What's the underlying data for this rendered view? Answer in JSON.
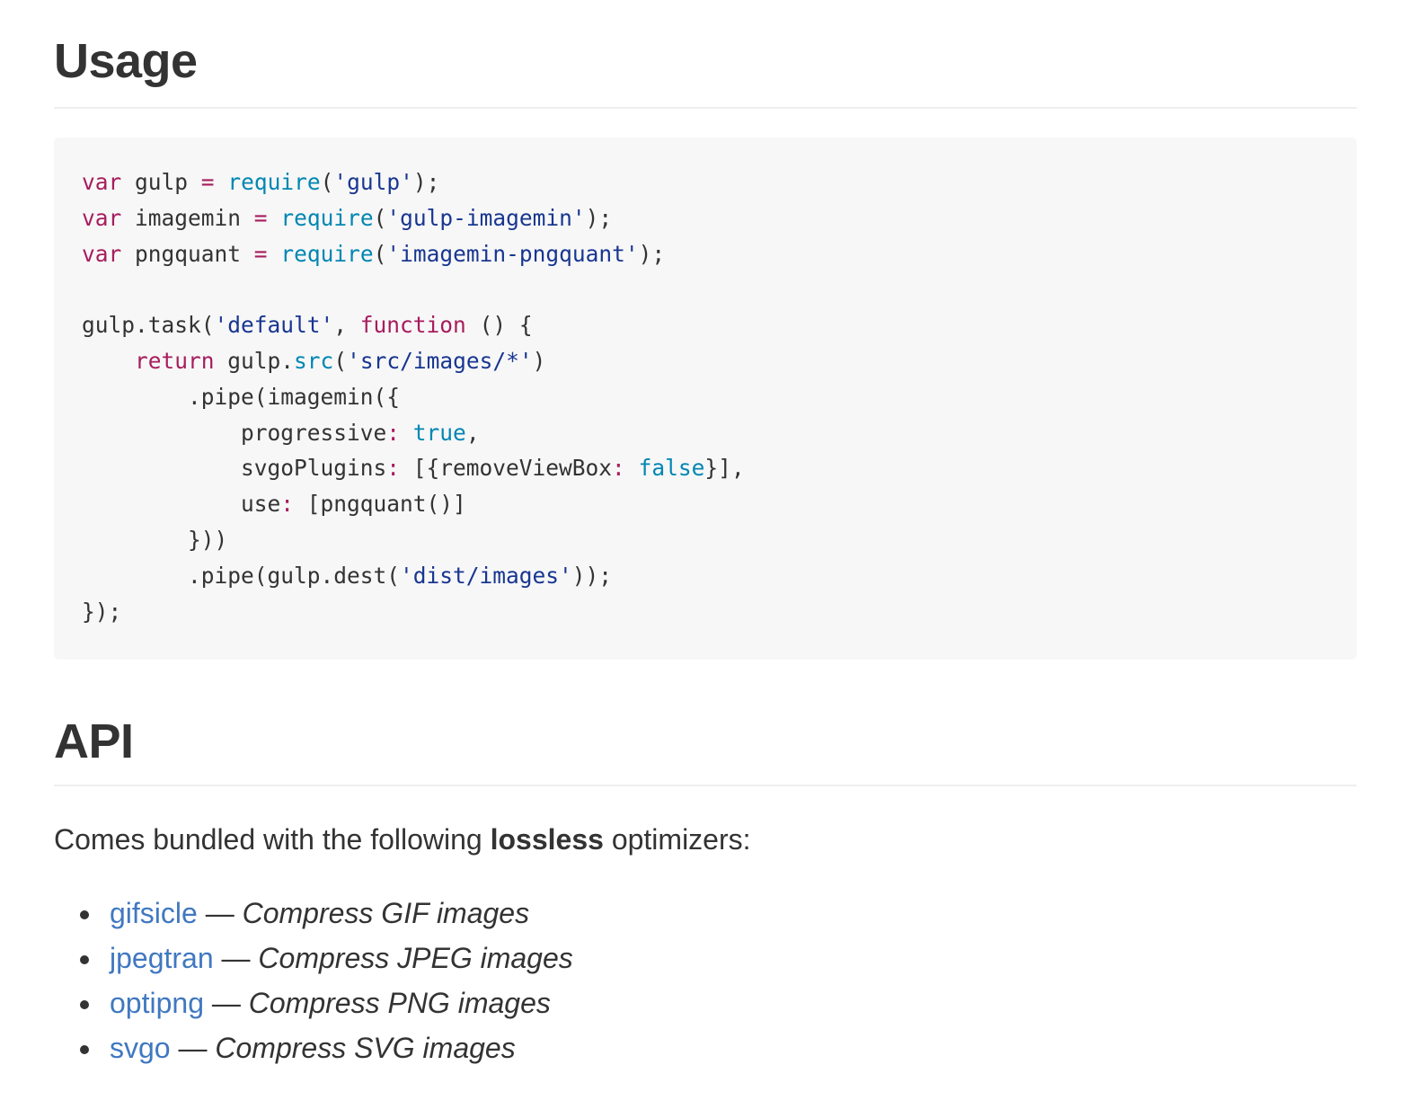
{
  "usage": {
    "heading": "Usage"
  },
  "code": {
    "lines": [
      [
        {
          "t": "kw",
          "v": "var"
        },
        {
          "t": "plain",
          "v": " gulp "
        },
        {
          "t": "op",
          "v": "="
        },
        {
          "t": "plain",
          "v": " "
        },
        {
          "t": "fn",
          "v": "require"
        },
        {
          "t": "plain",
          "v": "("
        },
        {
          "t": "str",
          "v": "'gulp'"
        },
        {
          "t": "plain",
          "v": ");"
        }
      ],
      [
        {
          "t": "kw",
          "v": "var"
        },
        {
          "t": "plain",
          "v": " imagemin "
        },
        {
          "t": "op",
          "v": "="
        },
        {
          "t": "plain",
          "v": " "
        },
        {
          "t": "fn",
          "v": "require"
        },
        {
          "t": "plain",
          "v": "("
        },
        {
          "t": "str",
          "v": "'gulp-imagemin'"
        },
        {
          "t": "plain",
          "v": ");"
        }
      ],
      [
        {
          "t": "kw",
          "v": "var"
        },
        {
          "t": "plain",
          "v": " pngquant "
        },
        {
          "t": "op",
          "v": "="
        },
        {
          "t": "plain",
          "v": " "
        },
        {
          "t": "fn",
          "v": "require"
        },
        {
          "t": "plain",
          "v": "("
        },
        {
          "t": "str",
          "v": "'imagemin-pngquant'"
        },
        {
          "t": "plain",
          "v": ");"
        }
      ],
      [],
      [
        {
          "t": "plain",
          "v": "gulp.task("
        },
        {
          "t": "str",
          "v": "'default'"
        },
        {
          "t": "plain",
          "v": ", "
        },
        {
          "t": "kw",
          "v": "function"
        },
        {
          "t": "plain",
          "v": " () {"
        }
      ],
      [
        {
          "t": "plain",
          "v": "    "
        },
        {
          "t": "kw",
          "v": "return"
        },
        {
          "t": "plain",
          "v": " gulp."
        },
        {
          "t": "fn",
          "v": "src"
        },
        {
          "t": "plain",
          "v": "("
        },
        {
          "t": "str",
          "v": "'src/images/*'"
        },
        {
          "t": "plain",
          "v": ")"
        }
      ],
      [
        {
          "t": "plain",
          "v": "        .pipe(imagemin({"
        }
      ],
      [
        {
          "t": "plain",
          "v": "            progressive"
        },
        {
          "t": "op",
          "v": ":"
        },
        {
          "t": "plain",
          "v": " "
        },
        {
          "t": "fn",
          "v": "true"
        },
        {
          "t": "plain",
          "v": ","
        }
      ],
      [
        {
          "t": "plain",
          "v": "            svgoPlugins"
        },
        {
          "t": "op",
          "v": ":"
        },
        {
          "t": "plain",
          "v": " [{removeViewBox"
        },
        {
          "t": "op",
          "v": ":"
        },
        {
          "t": "plain",
          "v": " "
        },
        {
          "t": "fn",
          "v": "false"
        },
        {
          "t": "plain",
          "v": "}],"
        }
      ],
      [
        {
          "t": "plain",
          "v": "            use"
        },
        {
          "t": "op",
          "v": ":"
        },
        {
          "t": "plain",
          "v": " [pngquant()]"
        }
      ],
      [
        {
          "t": "plain",
          "v": "        }))"
        }
      ],
      [
        {
          "t": "plain",
          "v": "        .pipe(gulp.dest("
        },
        {
          "t": "str",
          "v": "'dist/images'"
        },
        {
          "t": "plain",
          "v": "));"
        }
      ],
      [
        {
          "t": "plain",
          "v": "});"
        }
      ]
    ]
  },
  "api": {
    "heading": "API",
    "intro_before": "Comes bundled with the following ",
    "intro_bold": "lossless",
    "intro_after": " optimizers:",
    "optimizers": [
      {
        "name": "gifsicle",
        "dash": " — ",
        "desc": "Compress GIF images"
      },
      {
        "name": "jpegtran",
        "dash": " — ",
        "desc": "Compress JPEG images"
      },
      {
        "name": "optipng",
        "dash": " — ",
        "desc": "Compress PNG images"
      },
      {
        "name": "svgo",
        "dash": " — ",
        "desc": "Compress SVG images"
      }
    ]
  },
  "colors": {
    "text": "#333333",
    "link": "#4078c0",
    "code_bg": "#f7f7f7",
    "keyword": "#a71d5d",
    "builtin": "#0086b3",
    "string": "#183691",
    "rule": "#eeeeee"
  }
}
